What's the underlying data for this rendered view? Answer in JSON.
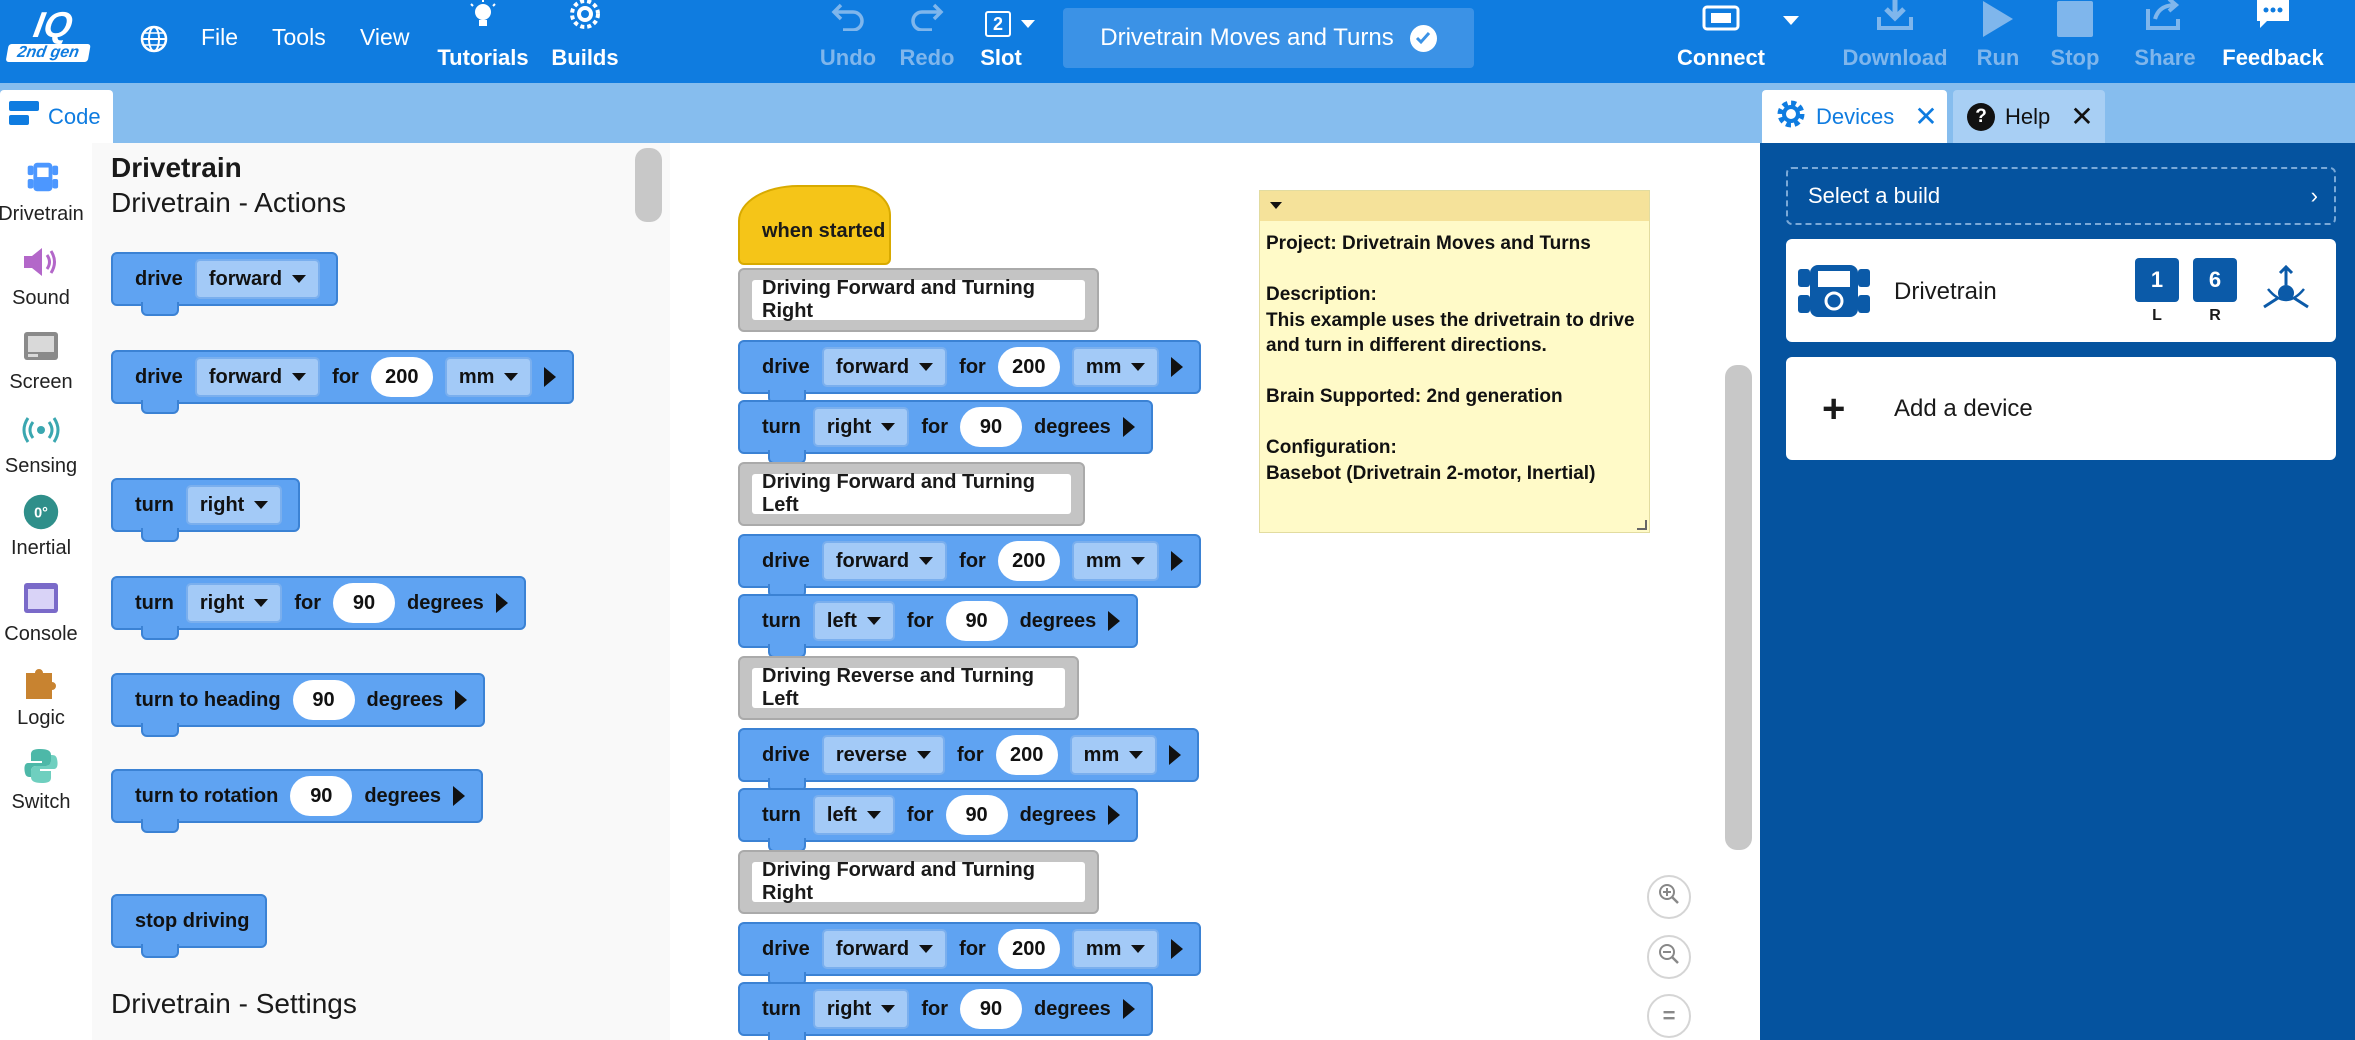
{
  "topbar": {
    "logo_main": "IQ",
    "logo_sub": "2nd gen",
    "menu": [
      "File",
      "Tools",
      "View"
    ],
    "tutorials": "Tutorials",
    "builds": "Builds",
    "undo": "Undo",
    "redo": "Redo",
    "slot_value": "2",
    "slot_label": "Slot",
    "project_title": "Drivetrain Moves and Turns",
    "connect": "Connect",
    "download": "Download",
    "run": "Run",
    "stop": "Stop",
    "share": "Share",
    "feedback": "Feedback"
  },
  "tabs": {
    "code": "Code",
    "devices": "Devices",
    "help": "Help"
  },
  "categories": [
    "Drivetrain",
    "Sound",
    "Screen",
    "Sensing",
    "Inertial",
    "Console",
    "Logic",
    "Switch"
  ],
  "colors": {
    "primary": "#0f7ce0",
    "motion_block": "#5fa3f2",
    "event_block": "#f5c518",
    "device_panel": "#05539f"
  },
  "toolbox": {
    "heading": "Drivetrain",
    "section_actions": "Drivetrain - Actions",
    "section_settings": "Drivetrain - Settings",
    "blocks": {
      "b1": {
        "w1": "drive",
        "d1": "forward"
      },
      "b2": {
        "w1": "drive",
        "d1": "forward",
        "w2": "for",
        "n1": "200",
        "d2": "mm"
      },
      "b3": {
        "w1": "turn",
        "d1": "right"
      },
      "b4": {
        "w1": "turn",
        "d1": "right",
        "w2": "for",
        "n1": "90",
        "w3": "degrees"
      },
      "b5": {
        "w1": "turn to heading",
        "n1": "90",
        "w2": "degrees"
      },
      "b6": {
        "w1": "turn to rotation",
        "n1": "90",
        "w2": "degrees"
      },
      "b7": {
        "w1": "stop driving"
      }
    }
  },
  "workspace": {
    "hat": "when started",
    "c1": "Driving Forward and Turning Right",
    "s1": {
      "w1": "drive",
      "d1": "forward",
      "w2": "for",
      "n1": "200",
      "d2": "mm"
    },
    "s2": {
      "w1": "turn",
      "d1": "right",
      "w2": "for",
      "n1": "90",
      "w3": "degrees"
    },
    "c2": "Driving Forward and Turning Left",
    "s3": {
      "w1": "drive",
      "d1": "forward",
      "w2": "for",
      "n1": "200",
      "d2": "mm"
    },
    "s4": {
      "w1": "turn",
      "d1": "left",
      "w2": "for",
      "n1": "90",
      "w3": "degrees"
    },
    "c3": "Driving Reverse and Turning Left",
    "s5": {
      "w1": "drive",
      "d1": "reverse",
      "w2": "for",
      "n1": "200",
      "d2": "mm"
    },
    "s6": {
      "w1": "turn",
      "d1": "left",
      "w2": "for",
      "n1": "90",
      "w3": "degrees"
    },
    "c4": "Driving Forward and Turning Right",
    "s7": {
      "w1": "drive",
      "d1": "forward",
      "w2": "for",
      "n1": "200",
      "d2": "mm"
    },
    "s8": {
      "w1": "turn",
      "d1": "right",
      "w2": "for",
      "n1": "90",
      "w3": "degrees"
    },
    "note": "Project: Drivetrain Moves and Turns\n\nDescription:\nThis example uses the drivetrain to drive and turn in different directions.\n\nBrain Supported: 2nd generation\n\nConfiguration:\nBasebot (Drivetrain 2-motor, Inertial)"
  },
  "devices": {
    "select_build": "Select a build",
    "device_name": "Drivetrain",
    "port_left": "1",
    "port_left_label": "L",
    "port_right": "6",
    "port_right_label": "R",
    "add_device": "Add a device"
  }
}
